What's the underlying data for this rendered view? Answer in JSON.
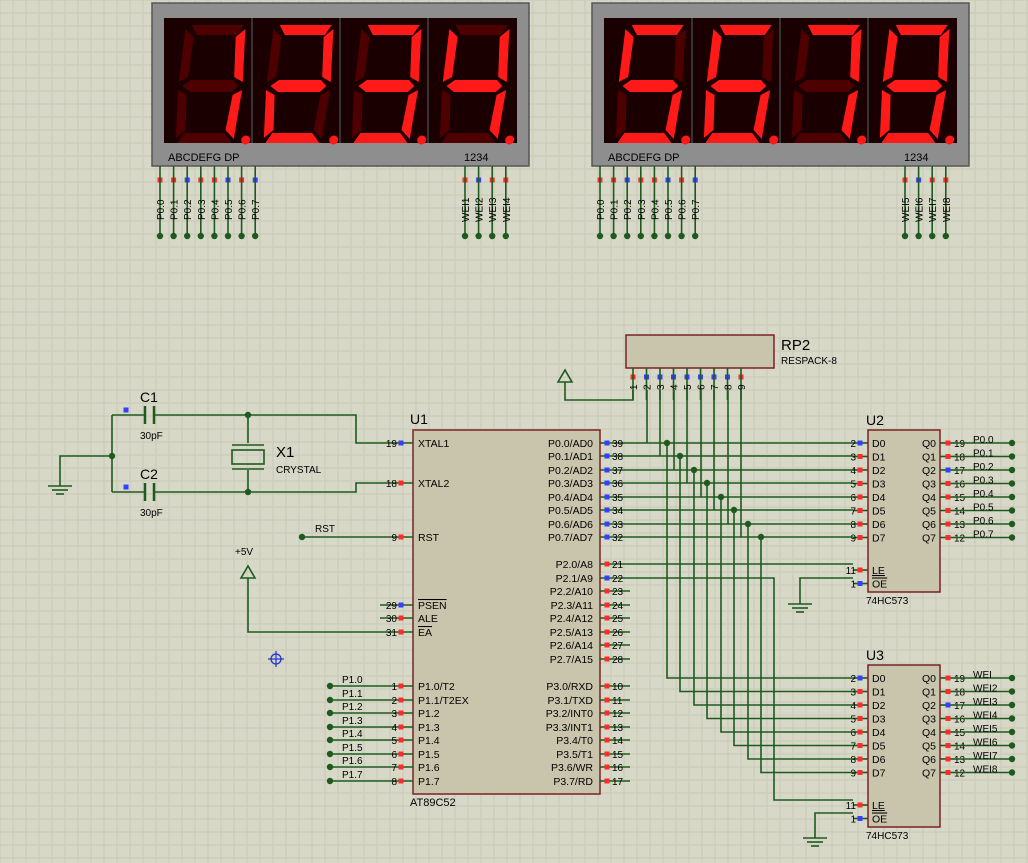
{
  "colors": {
    "background": "#d8d8c8",
    "grid": "#c9c9b6",
    "wire": "#1e5a1e",
    "chip_fill": "#c9c4ac",
    "chip_border": "#7a2222",
    "display_bezel": "#8e8e8e",
    "display_inner": "#1a0000",
    "segment_on": "#ff1a1a",
    "segment_off": "#4e0000",
    "pin_red": "#ff2a2a",
    "pin_blue": "#3340ff",
    "label": "#000000"
  },
  "display1": {
    "digits": [
      "1",
      "2",
      "3",
      "4"
    ],
    "seg_label": "ABCDEFG DP",
    "digit_label": "1234",
    "seg_pins": [
      "P0.0",
      "P0.1",
      "P0.2",
      "P0.3",
      "P0.4",
      "P0.5",
      "P0.6",
      "P0.7"
    ],
    "com_pins": [
      "WEI1",
      "WEI2",
      "WEI3",
      "WEI4"
    ]
  },
  "display2": {
    "digits": [
      "5",
      "6",
      "7",
      "8"
    ],
    "seg_label": "ABCDEFG DP",
    "digit_label": "1234",
    "seg_pins": [
      "P0.0",
      "P0.1",
      "P0.2",
      "P0.3",
      "P0.4",
      "P0.5",
      "P0.6",
      "P0.7"
    ],
    "com_pins": [
      "WEI5",
      "WEI6",
      "WEI7",
      "WEI8"
    ]
  },
  "rp2": {
    "ref": "RP2",
    "part": "RESPACK-8",
    "pins": [
      "1",
      "2",
      "3",
      "4",
      "5",
      "6",
      "7",
      "8",
      "9"
    ]
  },
  "c1": {
    "ref": "C1",
    "value": "30pF"
  },
  "c2": {
    "ref": "C2",
    "value": "30pF"
  },
  "x1": {
    "ref": "X1",
    "value": "CRYSTAL"
  },
  "power_label": "+5V",
  "rst_label": "RST",
  "u1": {
    "ref": "U1",
    "part": "AT89C52",
    "left_pins": [
      {
        "num": "19",
        "name": "XTAL1"
      },
      {
        "num": "18",
        "name": "XTAL2"
      },
      {
        "num": "9",
        "name": "RST"
      },
      {
        "num": "29",
        "name": "PSEN"
      },
      {
        "num": "30",
        "name": "ALE"
      },
      {
        "num": "31",
        "name": "EA"
      },
      {
        "num": "1",
        "name": "P1.0/T2"
      },
      {
        "num": "2",
        "name": "P1.1/T2EX"
      },
      {
        "num": "3",
        "name": "P1.2"
      },
      {
        "num": "4",
        "name": "P1.3"
      },
      {
        "num": "5",
        "name": "P1.4"
      },
      {
        "num": "6",
        "name": "P1.5"
      },
      {
        "num": "7",
        "name": "P1.6"
      },
      {
        "num": "8",
        "name": "P1.7"
      }
    ],
    "right_pins": [
      {
        "num": "39",
        "name": "P0.0/AD0"
      },
      {
        "num": "38",
        "name": "P0.1/AD1"
      },
      {
        "num": "37",
        "name": "P0.2/AD2"
      },
      {
        "num": "36",
        "name": "P0.3/AD3"
      },
      {
        "num": "35",
        "name": "P0.4/AD4"
      },
      {
        "num": "34",
        "name": "P0.5/AD5"
      },
      {
        "num": "33",
        "name": "P0.6/AD6"
      },
      {
        "num": "32",
        "name": "P0.7/AD7"
      },
      {
        "num": "21",
        "name": "P2.0/A8"
      },
      {
        "num": "22",
        "name": "P2.1/A9"
      },
      {
        "num": "23",
        "name": "P2.2/A10"
      },
      {
        "num": "24",
        "name": "P2.3/A11"
      },
      {
        "num": "25",
        "name": "P2.4/A12"
      },
      {
        "num": "26",
        "name": "P2.5/A13"
      },
      {
        "num": "27",
        "name": "P2.6/A14"
      },
      {
        "num": "28",
        "name": "P2.7/A15"
      },
      {
        "num": "10",
        "name": "P3.0/RXD"
      },
      {
        "num": "11",
        "name": "P3.1/TXD"
      },
      {
        "num": "12",
        "name": "P3.2/INT0"
      },
      {
        "num": "13",
        "name": "P3.3/INT1"
      },
      {
        "num": "14",
        "name": "P3.4/T0"
      },
      {
        "num": "15",
        "name": "P3.5/T1"
      },
      {
        "num": "16",
        "name": "P3.6/WR"
      },
      {
        "num": "17",
        "name": "P3.7/RD"
      }
    ],
    "p1_net_labels": [
      "P1.0",
      "P1.1",
      "P1.2",
      "P1.3",
      "P1.4",
      "P1.5",
      "P1.6",
      "P1.7"
    ]
  },
  "u2": {
    "ref": "U2",
    "part": "74HC573",
    "inputs": [
      {
        "num": "2",
        "name": "D0"
      },
      {
        "num": "3",
        "name": "D1"
      },
      {
        "num": "4",
        "name": "D2"
      },
      {
        "num": "5",
        "name": "D3"
      },
      {
        "num": "6",
        "name": "D4"
      },
      {
        "num": "7",
        "name": "D5"
      },
      {
        "num": "8",
        "name": "D6"
      },
      {
        "num": "9",
        "name": "D7"
      }
    ],
    "controls": [
      {
        "num": "11",
        "name": "LE"
      },
      {
        "num": "1",
        "name": "OE"
      }
    ],
    "outputs": [
      {
        "num": "19",
        "name": "Q0"
      },
      {
        "num": "18",
        "name": "Q1"
      },
      {
        "num": "17",
        "name": "Q2"
      },
      {
        "num": "16",
        "name": "Q3"
      },
      {
        "num": "15",
        "name": "Q4"
      },
      {
        "num": "14",
        "name": "Q5"
      },
      {
        "num": "13",
        "name": "Q6"
      },
      {
        "num": "12",
        "name": "Q7"
      }
    ],
    "net_labels": [
      "P0.0",
      "P0.1",
      "P0.2",
      "P0.3",
      "P0.4",
      "P0.5",
      "P0.6",
      "P0.7"
    ]
  },
  "u3": {
    "ref": "U3",
    "part": "74HC573",
    "inputs": [
      {
        "num": "2",
        "name": "D0"
      },
      {
        "num": "3",
        "name": "D1"
      },
      {
        "num": "4",
        "name": "D2"
      },
      {
        "num": "5",
        "name": "D3"
      },
      {
        "num": "6",
        "name": "D4"
      },
      {
        "num": "7",
        "name": "D5"
      },
      {
        "num": "8",
        "name": "D6"
      },
      {
        "num": "9",
        "name": "D7"
      }
    ],
    "controls": [
      {
        "num": "11",
        "name": "LE"
      },
      {
        "num": "1",
        "name": "OE"
      }
    ],
    "outputs": [
      {
        "num": "19",
        "name": "Q0"
      },
      {
        "num": "18",
        "name": "Q1"
      },
      {
        "num": "17",
        "name": "Q2"
      },
      {
        "num": "16",
        "name": "Q3"
      },
      {
        "num": "15",
        "name": "Q4"
      },
      {
        "num": "14",
        "name": "Q5"
      },
      {
        "num": "13",
        "name": "Q6"
      },
      {
        "num": "12",
        "name": "Q7"
      }
    ],
    "net_labels": [
      "WEI",
      "WEI2",
      "WEI3",
      "WEI4",
      "WEI5",
      "WEI6",
      "WEI7",
      "WEI8"
    ]
  }
}
